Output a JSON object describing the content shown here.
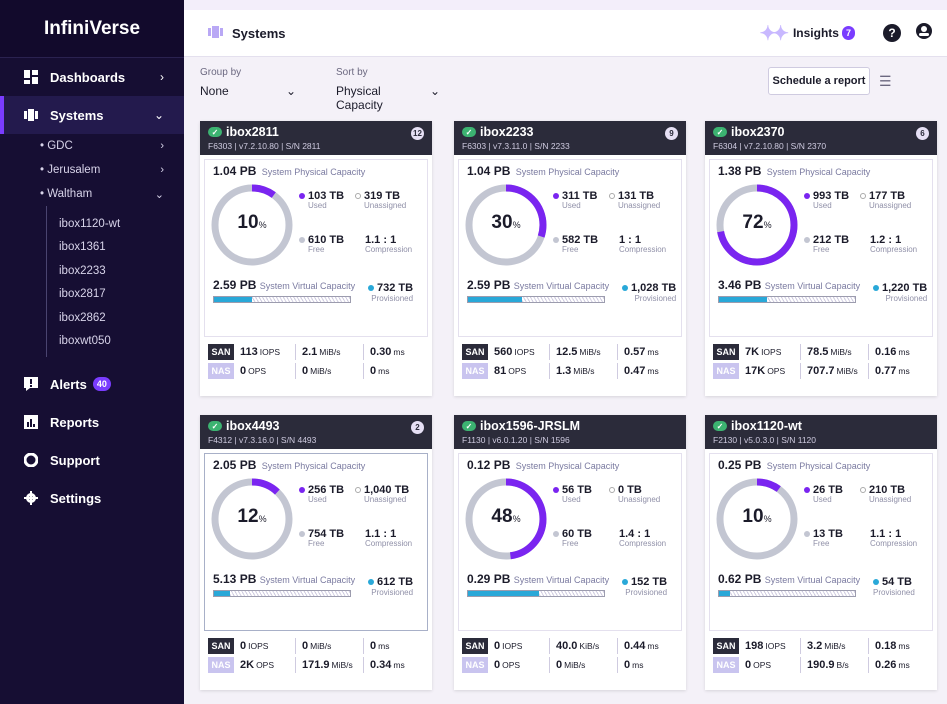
{
  "app": {
    "name": "InfiniVerse"
  },
  "sidebar": {
    "items": [
      {
        "label": "Dashboards"
      },
      {
        "label": "Systems"
      },
      {
        "label": "Alerts",
        "badge": "40"
      },
      {
        "label": "Reports"
      },
      {
        "label": "Support"
      },
      {
        "label": "Settings"
      }
    ],
    "sub": [
      {
        "label": "• GDC"
      },
      {
        "label": "• Jerusalem"
      },
      {
        "label": "• Waltham"
      }
    ],
    "leaves": [
      "ibox1120-wt",
      "ibox1361",
      "ibox2233",
      "ibox2817",
      "ibox2862",
      "iboxwt050"
    ]
  },
  "header": {
    "title": "Systems",
    "insights_label": "Insights",
    "insights_count": "7"
  },
  "controls": {
    "group_label": "Group by",
    "group_value": "None",
    "sort_label": "Sort by",
    "sort_value": "Physical Capacity",
    "report_button": "Schedule a report"
  },
  "labels": {
    "phys": "System Physical Capacity",
    "virt": "System Virtual Capacity",
    "used": "Used",
    "unassigned": "Unassigned",
    "free": "Free",
    "compression": "Compression",
    "provisioned": "Provisioned",
    "san": "SAN",
    "nas": "NAS"
  },
  "cards": [
    {
      "name": "ibox2811",
      "alerts": "12",
      "sub": "F6303 | v7.2.10.80 | S/N 2811",
      "phys": "1.04 PB",
      "pct": 10,
      "used": "103 TB",
      "unassigned": "319 TB",
      "free": "610 TB",
      "compression": "1.1 : 1",
      "virt": "2.59 PB",
      "virt_pct": 28,
      "provisioned": "732 TB",
      "san": {
        "iops": "113",
        "iops_u": "IOPS",
        "thr": "2.1",
        "thr_u": "MiB/s",
        "lat": "0.30",
        "lat_u": "ms"
      },
      "nas": {
        "iops": "0",
        "iops_u": "OPS",
        "thr": "0",
        "thr_u": "MiB/s",
        "lat": "0",
        "lat_u": "ms"
      }
    },
    {
      "name": "ibox2233",
      "alerts": "9",
      "sub": "F6303 | v7.3.11.0 | S/N 2233",
      "phys": "1.04 PB",
      "pct": 30,
      "used": "311 TB",
      "unassigned": "131 TB",
      "free": "582 TB",
      "compression": "1 : 1",
      "virt": "2.59 PB",
      "virt_pct": 40,
      "provisioned": "1,028 TB",
      "san": {
        "iops": "560",
        "iops_u": "IOPS",
        "thr": "12.5",
        "thr_u": "MiB/s",
        "lat": "0.57",
        "lat_u": "ms"
      },
      "nas": {
        "iops": "81",
        "iops_u": "OPS",
        "thr": "1.3",
        "thr_u": "MiB/s",
        "lat": "0.47",
        "lat_u": "ms"
      }
    },
    {
      "name": "ibox2370",
      "alerts": "6",
      "sub": "F6304 | v7.2.10.80 | S/N 2370",
      "phys": "1.38 PB",
      "pct": 72,
      "used": "993 TB",
      "unassigned": "177 TB",
      "free": "212 TB",
      "compression": "1.2 : 1",
      "virt": "3.46 PB",
      "virt_pct": 35,
      "provisioned": "1,220 TB",
      "san": {
        "iops": "7K",
        "iops_u": "IOPS",
        "thr": "78.5",
        "thr_u": "MiB/s",
        "lat": "0.16",
        "lat_u": "ms"
      },
      "nas": {
        "iops": "17K",
        "iops_u": "OPS",
        "thr": "707.7",
        "thr_u": "MiB/s",
        "lat": "0.77",
        "lat_u": "ms"
      }
    },
    {
      "name": "ibox4493",
      "alerts": "2",
      "sub": "F4312 | v7.3.16.0 | S/N 4493",
      "phys": "2.05 PB",
      "pct": 12,
      "used": "256 TB",
      "unassigned": "1,040 TB",
      "free": "754 TB",
      "compression": "1.1 : 1",
      "virt": "5.13 PB",
      "virt_pct": 12,
      "provisioned": "612 TB",
      "san": {
        "iops": "0",
        "iops_u": "IOPS",
        "thr": "0",
        "thr_u": "MiB/s",
        "lat": "0",
        "lat_u": "ms"
      },
      "nas": {
        "iops": "2K",
        "iops_u": "OPS",
        "thr": "171.9",
        "thr_u": "MiB/s",
        "lat": "0.34",
        "lat_u": "ms"
      }
    },
    {
      "name": "ibox1596-JRSLM",
      "alerts": "",
      "sub": "F1130 | v6.0.1.20 | S/N 1596",
      "phys": "0.12 PB",
      "pct": 48,
      "used": "56 TB",
      "unassigned": "0 TB",
      "free": "60 TB",
      "compression": "1.4 : 1",
      "virt": "0.29 PB",
      "virt_pct": 52,
      "provisioned": "152 TB",
      "san": {
        "iops": "0",
        "iops_u": "IOPS",
        "thr": "40.0",
        "thr_u": "KiB/s",
        "lat": "0.44",
        "lat_u": "ms"
      },
      "nas": {
        "iops": "0",
        "iops_u": "OPS",
        "thr": "0",
        "thr_u": "MiB/s",
        "lat": "0",
        "lat_u": "ms"
      }
    },
    {
      "name": "ibox1120-wt",
      "alerts": "",
      "sub": "F2130 | v5.0.3.0 | S/N 1120",
      "phys": "0.25 PB",
      "pct": 10,
      "used": "26 TB",
      "unassigned": "210 TB",
      "free": "13 TB",
      "compression": "1.1 : 1",
      "virt": "0.62 PB",
      "virt_pct": 8,
      "provisioned": "54 TB",
      "san": {
        "iops": "198",
        "iops_u": "IOPS",
        "thr": "3.2",
        "thr_u": "MiB/s",
        "lat": "0.18",
        "lat_u": "ms"
      },
      "nas": {
        "iops": "0",
        "iops_u": "OPS",
        "thr": "190.9",
        "thr_u": "B/s",
        "lat": "0.26",
        "lat_u": "ms"
      }
    }
  ],
  "colors": {
    "accent": "#7a3cff",
    "sidebar": "#160e33",
    "card_header": "#2b2b3a",
    "provisioned": "#29a8d8"
  }
}
